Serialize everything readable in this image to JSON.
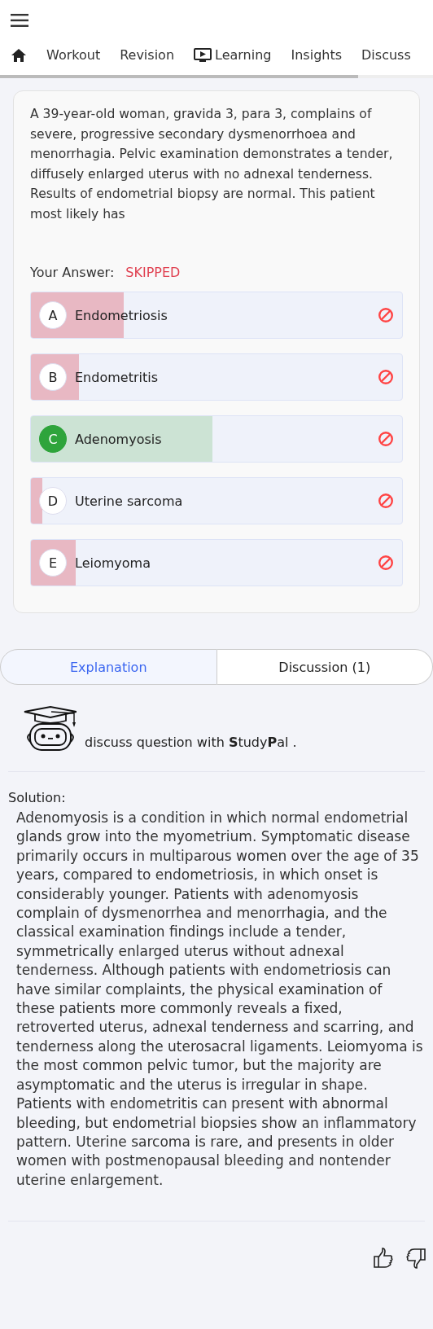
{
  "nav": {
    "tabs": [
      {
        "label": "Workout",
        "icon": false
      },
      {
        "label": "Revision",
        "icon": false
      },
      {
        "label": "Learning",
        "icon": true
      },
      {
        "label": "Insights",
        "icon": false
      },
      {
        "label": "Discuss",
        "icon": false
      }
    ]
  },
  "question": {
    "text": "A 39-year-old woman, gravida 3, para 3, complains of severe, progressive secondary dysmenorrhoea and menorrhagia. Pelvic examination demonstrates a tender, diffusely enlarged uterus with no adnexal tenderness. Results of endometrial biopsy are normal. This patient most likely has",
    "answer_label": "Your Answer:",
    "answer_value": "SKIPPED",
    "options": [
      {
        "letter": "A",
        "text": "Endometriosis",
        "correct": false,
        "level": 0.25
      },
      {
        "letter": "B",
        "text": "Endometritis",
        "correct": false,
        "level": 0.13
      },
      {
        "letter": "C",
        "text": "Adenomyosis",
        "correct": true,
        "level": 0.49
      },
      {
        "letter": "D",
        "text": "Uterine sarcoma",
        "correct": false,
        "level": 0.03
      },
      {
        "letter": "E",
        "text": "Leiomyoma",
        "correct": false,
        "level": 0.12
      }
    ]
  },
  "section_tabs": [
    {
      "label": "Explanation",
      "selected": true
    },
    {
      "label": "Discussion (1)",
      "selected": false
    }
  ],
  "studypal": {
    "text": "discuss question with **S**tudy**P**al ."
  },
  "solution": {
    "label": "Solution:",
    "text": "Adenomyosis is a condition in which normal endometrial glands grow into the myometrium. Symptomatic disease primarily occurs in multiparous women over the age of 35 years, compared to endometriosis, in which onset is considerably younger. Patients with adenomyosis complain of dysmenorrhea and menorrhagia, and the classical examination findings include a tender, symmetrically enlarged uterus without adnexal tenderness. Although patients with endometriosis can have similar complaints, the physical examination of these patients more commonly reveals a fixed, retroverted uterus, adnexal tenderness and scarring, and tenderness along the uterosacral ligaments. Leiomyoma is the most common pelvic tumor, but the majority are asymptomatic and the uterus is irregular in shape. Patients with endometritis can present with abnormal bleeding, but endometrial biopsies show an inflammatory pattern. Uterine sarcoma is rare, and presents in older women with postmenopausal bleeding and nontender uterine enlargement."
  }
}
